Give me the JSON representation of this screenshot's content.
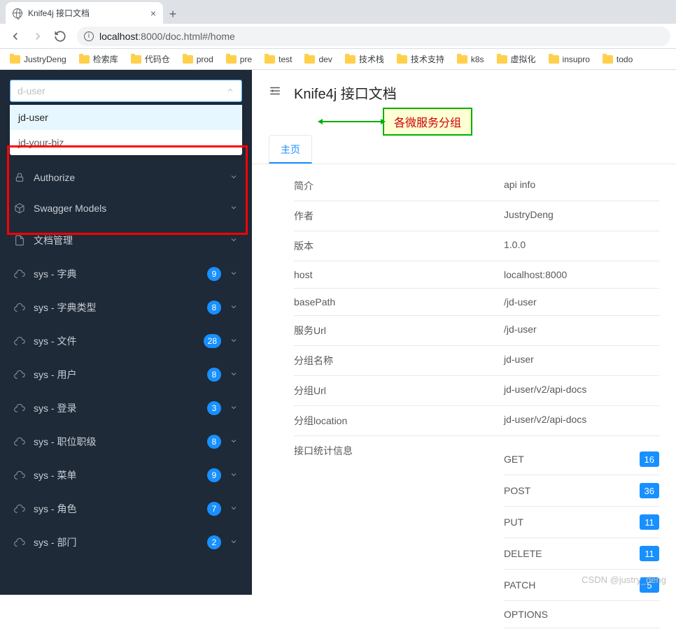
{
  "browser": {
    "tab_title": "Knife4j 接口文档",
    "url_host": "localhost",
    "url_port": ":8000",
    "url_path": "/doc.html#/home"
  },
  "bookmarks": [
    "JustryDeng",
    "检索库",
    "代码仓",
    "prod",
    "pre",
    "test",
    "dev",
    "技术栈",
    "技术支持",
    "k8s",
    "虚拟化",
    "insupro",
    "todo"
  ],
  "sidebar": {
    "select_value": "d-user",
    "options": [
      {
        "label": "jd-user",
        "selected": true
      },
      {
        "label": "jd-your-biz",
        "selected": false
      }
    ],
    "items": [
      {
        "icon": "lock",
        "label": "Authorize",
        "badge": null
      },
      {
        "icon": "box",
        "label": "Swagger Models",
        "badge": null
      },
      {
        "icon": "doc",
        "label": "文档管理",
        "badge": null
      },
      {
        "icon": "cloud",
        "label": "sys - 字典",
        "badge": "9"
      },
      {
        "icon": "cloud",
        "label": "sys - 字典类型",
        "badge": "8"
      },
      {
        "icon": "cloud",
        "label": "sys - 文件",
        "badge": "28"
      },
      {
        "icon": "cloud",
        "label": "sys - 用户",
        "badge": "8"
      },
      {
        "icon": "cloud",
        "label": "sys - 登录",
        "badge": "3"
      },
      {
        "icon": "cloud",
        "label": "sys - 职位职级",
        "badge": "8"
      },
      {
        "icon": "cloud",
        "label": "sys - 菜单",
        "badge": "9"
      },
      {
        "icon": "cloud",
        "label": "sys - 角色",
        "badge": "7"
      },
      {
        "icon": "cloud",
        "label": "sys - 部门",
        "badge": "2"
      }
    ]
  },
  "main": {
    "title": "Knife4j 接口文档",
    "annotation": "各微服务分组",
    "tab": "主页",
    "info": [
      {
        "label": "简介",
        "value": "api info"
      },
      {
        "label": "作者",
        "value": "JustryDeng"
      },
      {
        "label": "版本",
        "value": "1.0.0"
      },
      {
        "label": "host",
        "value": "localhost:8000"
      },
      {
        "label": "basePath",
        "value": "/jd-user"
      },
      {
        "label": "服务Url",
        "value": "/jd-user"
      },
      {
        "label": "分组名称",
        "value": "jd-user"
      },
      {
        "label": "分组Url",
        "value": "jd-user/v2/api-docs"
      },
      {
        "label": "分组location",
        "value": "jd-user/v2/api-docs"
      }
    ],
    "stats_label": "接口统计信息",
    "stats": [
      {
        "method": "GET",
        "count": "16"
      },
      {
        "method": "POST",
        "count": "36"
      },
      {
        "method": "PUT",
        "count": "11"
      },
      {
        "method": "DELETE",
        "count": "11"
      },
      {
        "method": "PATCH",
        "count": "5"
      },
      {
        "method": "OPTIONS",
        "count": ""
      }
    ]
  },
  "watermark": "CSDN @justry_deng"
}
